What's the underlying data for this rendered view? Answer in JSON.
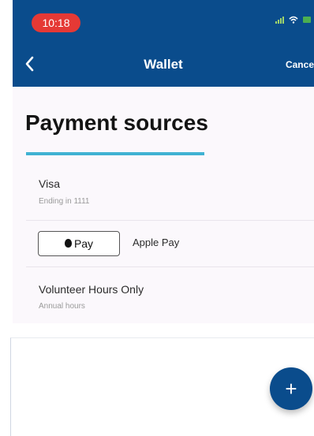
{
  "status": {
    "time": "10:18"
  },
  "nav": {
    "title": "Wallet",
    "action": "Cance"
  },
  "page": {
    "title": "Payment sources"
  },
  "sources": [
    {
      "title": "Visa",
      "subtitle": "Ending in 1111"
    },
    {
      "badge": "Pay",
      "title": "Apple Pay"
    },
    {
      "title": "Volunteer Hours Only",
      "subtitle": "Annual hours"
    }
  ],
  "fab": {
    "label": "+"
  },
  "colors": {
    "header": "#0a4c8c",
    "accent": "#3fb2d3",
    "time_badge": "#e53935"
  }
}
